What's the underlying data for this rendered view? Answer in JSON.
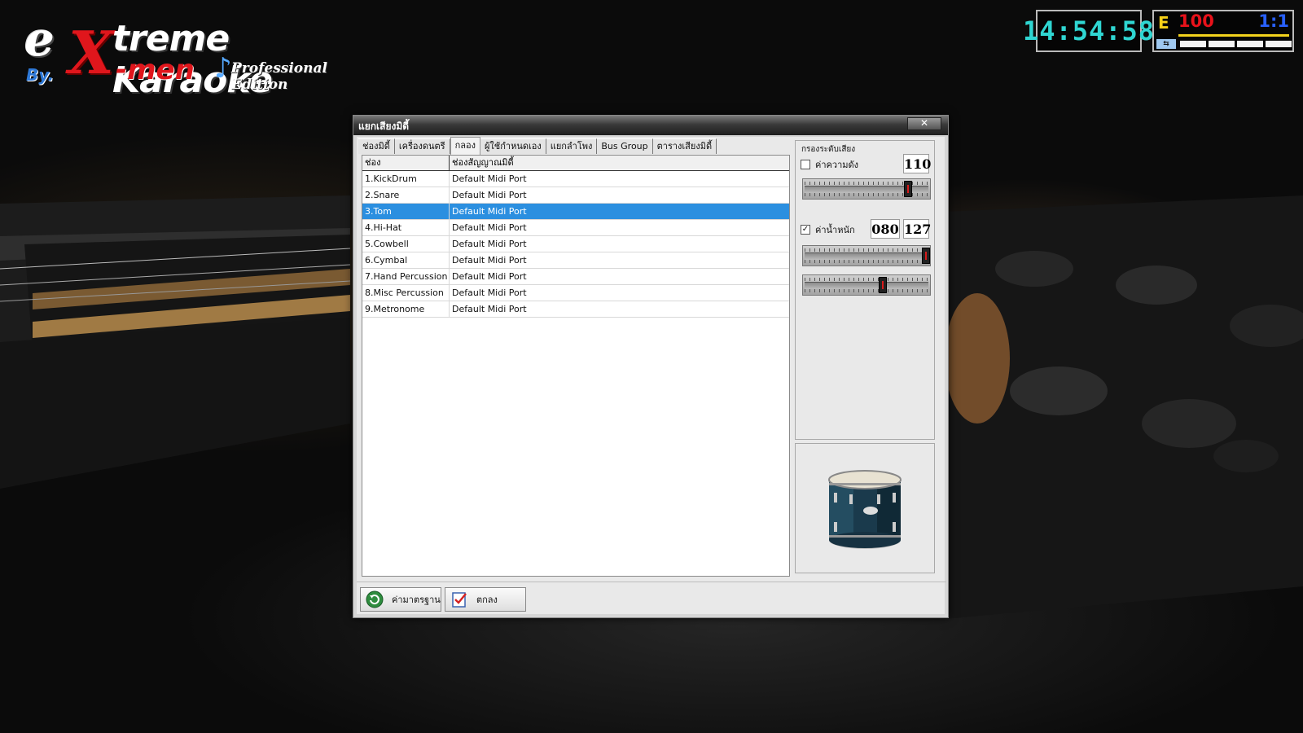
{
  "logo": {
    "line1_e": "e",
    "line1_x": "X",
    "line1_rest": "treme Karaoke",
    "line2_by": "By.",
    "line2_men": "-men",
    "line2_edition": "Professional Edition"
  },
  "clock": {
    "time": "14:54:58"
  },
  "status": {
    "key_label": "E",
    "volume": "100",
    "ratio": "1:1"
  },
  "dialog": {
    "title": "แยกเสียงมิดี้",
    "close_label": "✕",
    "tabs": [
      {
        "label": "ช่องมิดี้"
      },
      {
        "label": "เครื่องดนตรี"
      },
      {
        "label": "กลอง"
      },
      {
        "label": "ผู้ใช้กำหนดเอง"
      },
      {
        "label": "แยกลำโพง"
      },
      {
        "label": "Bus Group"
      },
      {
        "label": "ตารางเสียงมิดี้"
      }
    ],
    "active_tab": 2,
    "table": {
      "headers": [
        "ช่อง",
        "ช่องสัญญาณมิดี้"
      ],
      "rows": [
        [
          "1.KickDrum",
          "Default Midi Port"
        ],
        [
          "2.Snare",
          "Default Midi Port"
        ],
        [
          "3.Tom",
          "Default Midi Port"
        ],
        [
          "4.Hi-Hat",
          "Default Midi Port"
        ],
        [
          "5.Cowbell",
          "Default Midi Port"
        ],
        [
          "6.Cymbal",
          "Default Midi Port"
        ],
        [
          "7.Hand Percussion",
          "Default Midi Port"
        ],
        [
          "8.Misc Percussion",
          "Default Midi Port"
        ],
        [
          "9.Metronome",
          "Default Midi Port"
        ]
      ],
      "selected_row": 2
    },
    "filter": {
      "group_title": "กรองระดับเสียง",
      "volume_label": "ค่าความดัง",
      "volume_checked": false,
      "volume_value": "110",
      "volume_fraction": 0.85,
      "weight_label": "ค่าน้ำหนัก",
      "weight_checked": true,
      "weight_check_glyph": "✓",
      "weight_min_value": "080",
      "weight_max_value": "127",
      "weight_max_fraction": 1.0,
      "weight_min_fraction": 0.63
    },
    "buttons": {
      "default_label": "ค่ามาตรฐาน",
      "ok_label": "ตกลง"
    }
  }
}
